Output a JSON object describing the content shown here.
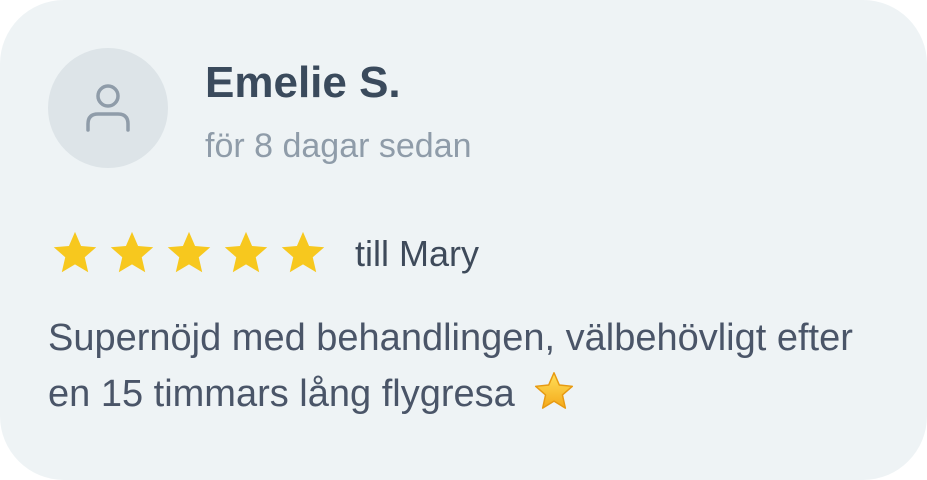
{
  "review": {
    "author": "Emelie S.",
    "time_ago": "för 8 dagar sedan",
    "rating": 5,
    "rating_max": 5,
    "recipient": "till Mary",
    "text": "Supernöjd med behandlingen, välbehövligt efter en 15 timmars lång flygresa",
    "trailing_emoji": "star-emoji"
  },
  "colors": {
    "card_background": "#eef3f5",
    "avatar_background": "#dde4e8",
    "star": "#f7c81e",
    "name_text": "#3a4a5c",
    "muted_text": "#8f9ca9",
    "body_text": "#4a5568"
  },
  "icons": {
    "avatar": "user-outline-icon",
    "rating": "star-icon"
  }
}
